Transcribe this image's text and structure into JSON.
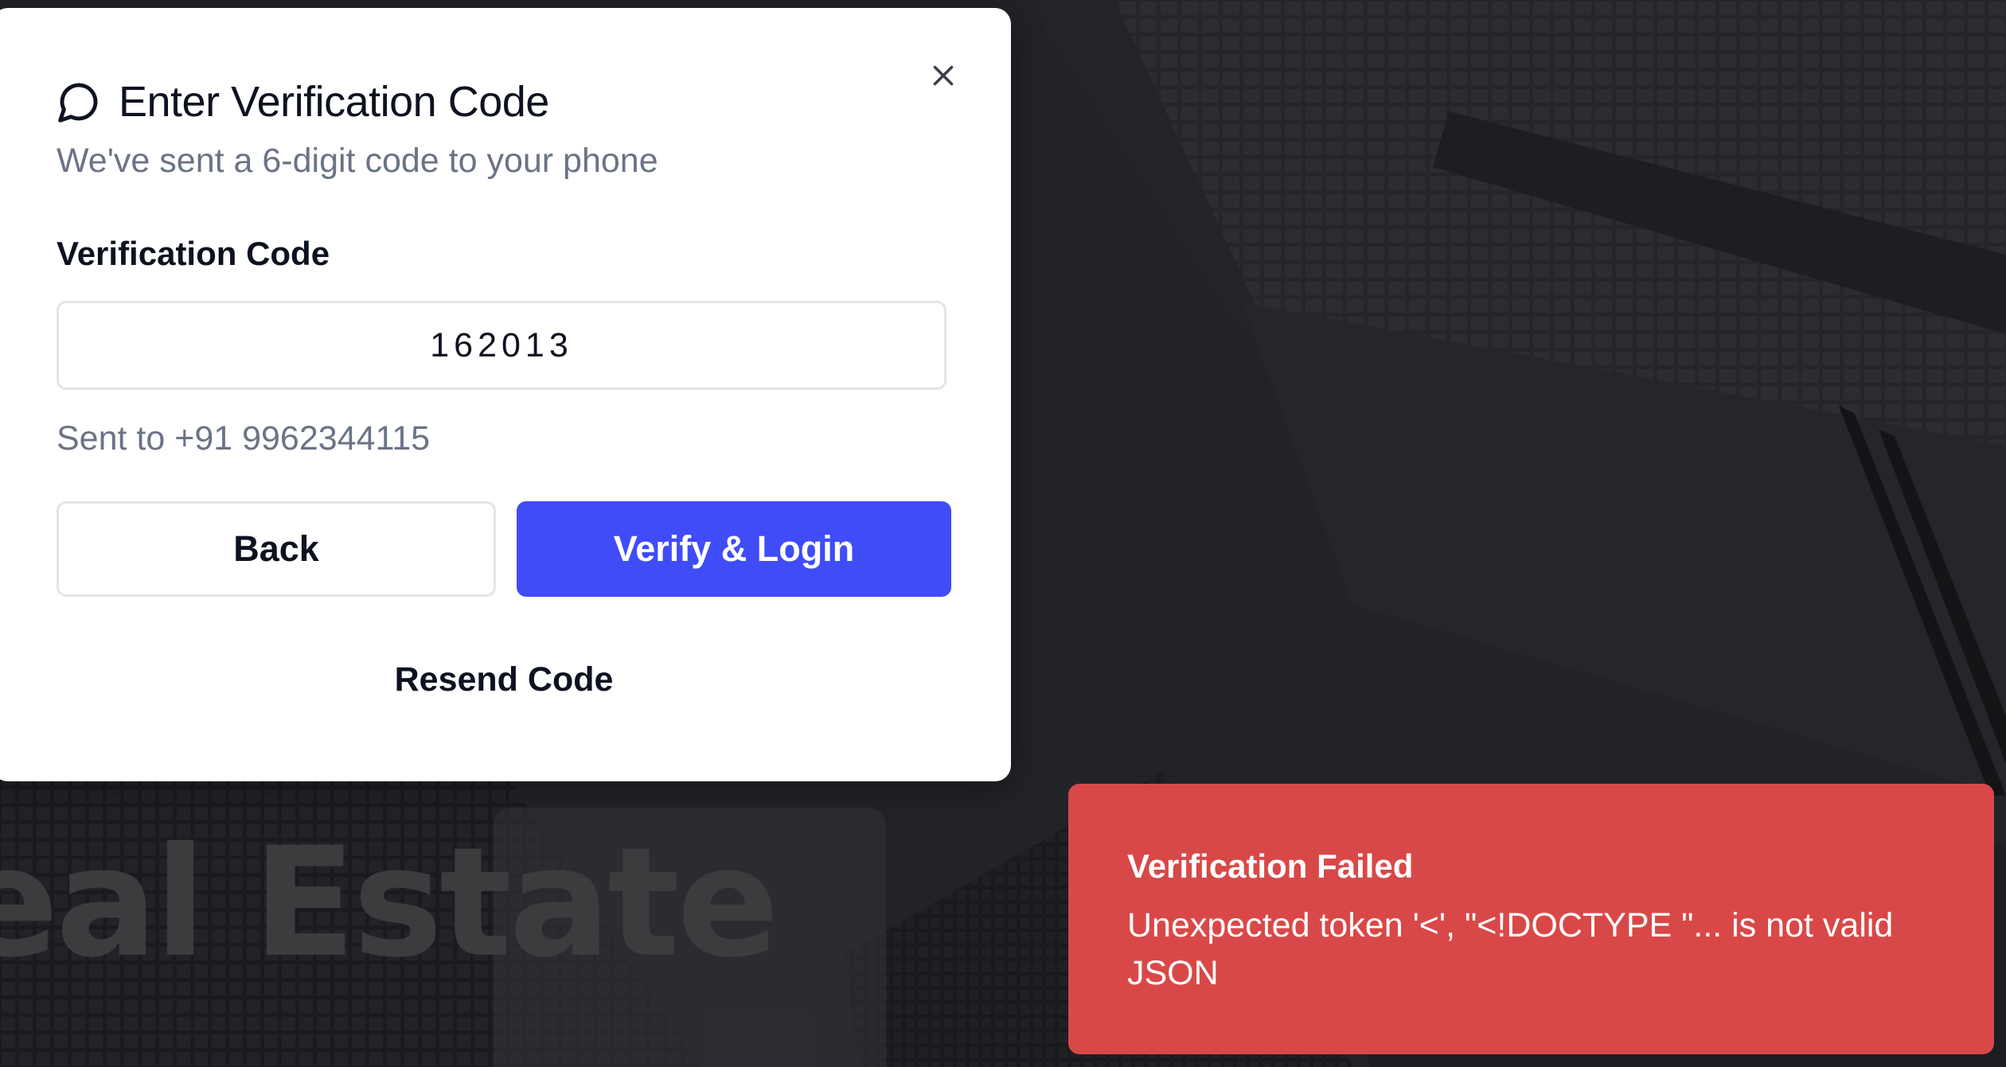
{
  "modal": {
    "title": "Enter Verification Code",
    "subtitle": "We've sent a 6-digit code to your phone",
    "field_label": "Verification Code",
    "code_value": "162013",
    "sent_to": "Sent to +91 9962344115",
    "back_label": "Back",
    "verify_label": "Verify & Login",
    "resend_label": "Resend Code",
    "title_icon": "message-circle-icon",
    "close_icon": "close-icon"
  },
  "background": {
    "hero_text": "eal Estate"
  },
  "toast": {
    "title": "Verification Failed",
    "message": "Unexpected token '<', \"<!DOCTYPE \"... is not valid JSON"
  },
  "colors": {
    "primary": "#3f4cf7",
    "error": "#d94848",
    "text": "#0d1220",
    "muted": "#6b7385"
  }
}
